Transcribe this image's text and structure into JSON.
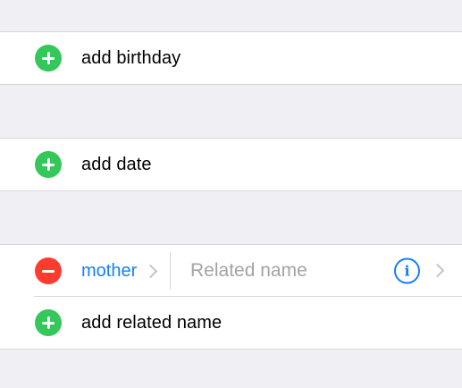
{
  "sections": {
    "birthday": {
      "add_label": "add birthday"
    },
    "date": {
      "add_label": "add date"
    },
    "related": {
      "entry": {
        "type_label": "mother",
        "name_placeholder": "Related name",
        "name_value": ""
      },
      "add_label": "add related name"
    }
  },
  "icons": {
    "add": "plus-circle-icon",
    "remove": "minus-circle-icon",
    "info": "info-icon",
    "chevron": "chevron-right-icon"
  },
  "colors": {
    "background": "#efeff4",
    "add_green": "#34c759",
    "remove_red": "#ff3b30",
    "accent_blue": "#147efb",
    "separator": "#d7d7db",
    "placeholder": "#a3a3a8"
  }
}
